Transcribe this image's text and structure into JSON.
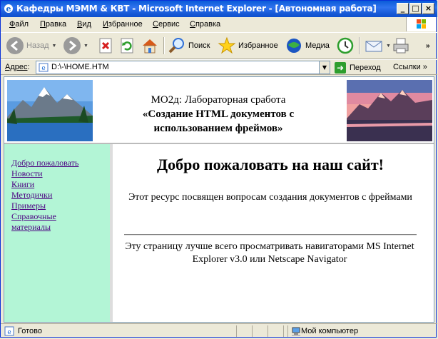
{
  "window": {
    "title": "Кафедры МЭММ & КВТ - Microsoft Internet Explorer - [Автономная работа]"
  },
  "menu": {
    "items": [
      {
        "first": "Ф",
        "rest": "айл"
      },
      {
        "first": "П",
        "rest": "равка"
      },
      {
        "first": "В",
        "rest": "ид"
      },
      {
        "first": "И",
        "rest": "збранное"
      },
      {
        "first": "С",
        "rest": "ервис"
      },
      {
        "first": "С",
        "rest": "правка"
      }
    ]
  },
  "toolbar": {
    "back": "Назад",
    "search": "Поиск",
    "favorites": "Избранное",
    "media": "Медиа"
  },
  "address": {
    "label_first": "Адрес",
    "label_rest": ":",
    "value": "D:\\-\\HOME.HTM",
    "go": "Переход",
    "links": "Ссылки"
  },
  "page": {
    "header_line1": "МО2д: Лабораторная сработа",
    "header_line2": "«Создание HTML документов с",
    "header_line3": "использованием фреймов»",
    "nav": [
      "Добро пожаловать",
      "Новости",
      "Книги",
      "Методички",
      "Примеры",
      "Справочные",
      "материалы"
    ],
    "heading": "Добро пожаловать на наш сайт!",
    "intro": "Этот ресурс посвящен вопросам создания документов с фреймами",
    "note": "Эту страницу лучше всего просматривать навигаторами MS Internet Explorer v3.0 или Netscape Navigator"
  },
  "status": {
    "text": "Готово",
    "zone": "Мой компьютер"
  },
  "colors": {
    "titlebar": "#0a5bd8",
    "nav_bg": "#b3f5d6",
    "link": "#4b0082"
  }
}
